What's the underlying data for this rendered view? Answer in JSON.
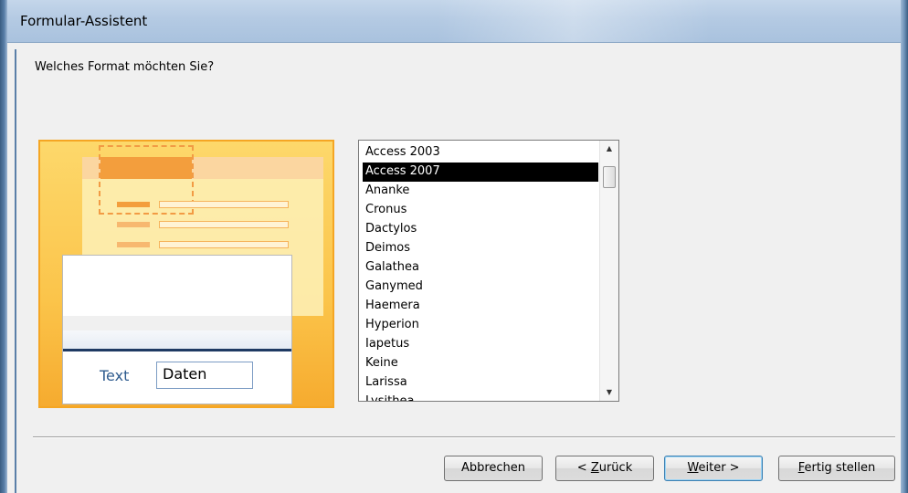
{
  "window": {
    "title": "Formular-Assistent"
  },
  "prompt": "Welches Format möchten Sie?",
  "preview": {
    "label_text": "Text",
    "field_text": "Daten"
  },
  "style_list": {
    "items": [
      "Access 2003",
      "Access 2007",
      "Ananke",
      "Cronus",
      "Dactylos",
      "Deimos",
      "Galathea",
      "Ganymed",
      "Haemera",
      "Hyperion",
      "Iapetus",
      "Keine",
      "Larissa",
      "Lysithea"
    ],
    "selected": "Access 2007"
  },
  "buttons": {
    "cancel": "Abbrechen",
    "back_prefix": "< ",
    "back_mnemonic": "Z",
    "back_rest": "urück",
    "next_mnemonic": "W",
    "next_rest": "eiter >",
    "finish_mnemonic": "F",
    "finish_rest": "ertig stellen"
  },
  "colors": {
    "accent": "#f5a623",
    "selection": "#000000",
    "titlebar": "#b4cae3"
  }
}
